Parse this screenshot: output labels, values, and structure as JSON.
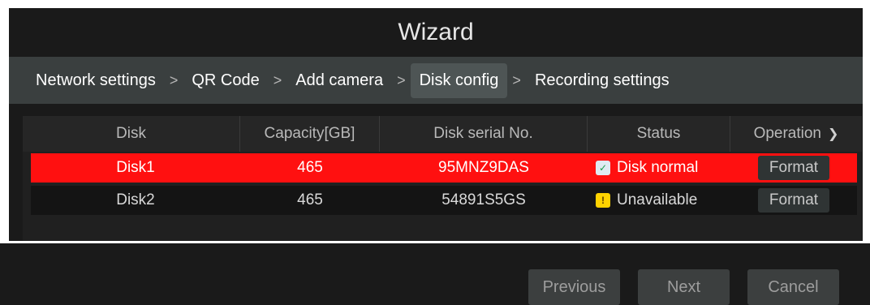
{
  "window": {
    "title": "Wizard"
  },
  "breadcrumb": {
    "items": [
      {
        "label": "Network settings"
      },
      {
        "label": "QR Code"
      },
      {
        "label": "Add camera"
      },
      {
        "label": "Disk config",
        "active": true
      },
      {
        "label": "Recording settings"
      }
    ],
    "separator": ">"
  },
  "table": {
    "headers": [
      "Disk",
      "Capacity[GB]",
      "Disk serial No.",
      "Status",
      "Operation"
    ],
    "rows": [
      {
        "disk": "Disk1",
        "capacity": "465",
        "serial": "95MNZ9DAS",
        "status": "Disk normal",
        "status_icon": "check-icon",
        "operation": "Format",
        "selected": true
      },
      {
        "disk": "Disk2",
        "capacity": "465",
        "serial": "54891S5GS",
        "status": "Unavailable",
        "status_icon": "warning-icon",
        "operation": "Format",
        "selected": false
      }
    ]
  },
  "footer": {
    "previous_label": "Previous",
    "next_label": "Next",
    "cancel_label": "Cancel"
  },
  "colors": {
    "selected_row": "#ff1010",
    "background": "#1a1a1a",
    "breadcrumb_bar": "#3a3f3f"
  }
}
